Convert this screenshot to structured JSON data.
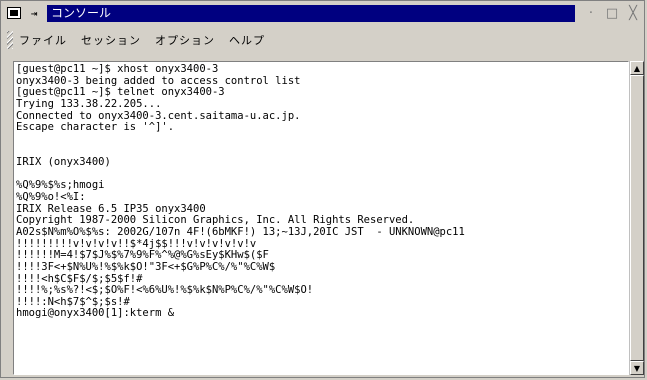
{
  "window": {
    "title": "コンソール",
    "pin_glyph": "⇥",
    "minimize": "·",
    "maximize": "□",
    "close": "╳"
  },
  "menubar": {
    "items": [
      "ファイル",
      "セッション",
      "オプション",
      "ヘルプ"
    ]
  },
  "terminal": {
    "lines": [
      "[guest@pc11 ~]$ xhost onyx3400-3",
      "onyx3400-3 being added to access control list",
      "[guest@pc11 ~]$ telnet onyx3400-3",
      "Trying 133.38.22.205...",
      "Connected to onyx3400-3.cent.saitama-u.ac.jp.",
      "Escape character is '^]'.",
      "",
      "",
      "IRIX (onyx3400)",
      "",
      "%Q%9%$%s;hmogi",
      "%Q%9%o!<%I:",
      "IRIX Release 6.5 IP35 onyx3400",
      "Copyright 1987-2000 Silicon Graphics, Inc. All Rights Reserved.",
      "A02s$N%m%O%$%s: 2002G/107n 4F!(6bMKF!) 13;~13J,20IC JST  - UNKNOWN@pc11",
      "!!!!!!!!!v!v!v!v!!$*4j$$!!!v!v!v!v!v!v",
      "!!!!!!M=4!$7$J%$%7%9%F%^%@%G%sEy$KHw$($F",
      "!!!!3F<+$N%U%!%$%k$O!\"3F<+$G%P%C%/%\"%C%W$",
      "!!!!<h$C$F$/$;$5$f!#",
      "!!!!%;%s%?!<$;$O%F!<%6%U%!%$%k$N%P%C%/%\"%C%W$O!",
      "!!!!:N<h$7$^$;$s!#",
      "hmogi@onyx3400[1]:kterm &"
    ]
  },
  "scrollbar": {
    "up_arrow": "▲",
    "down_arrow": "▼",
    "position": 0.0,
    "visible_fraction": 0.95
  }
}
